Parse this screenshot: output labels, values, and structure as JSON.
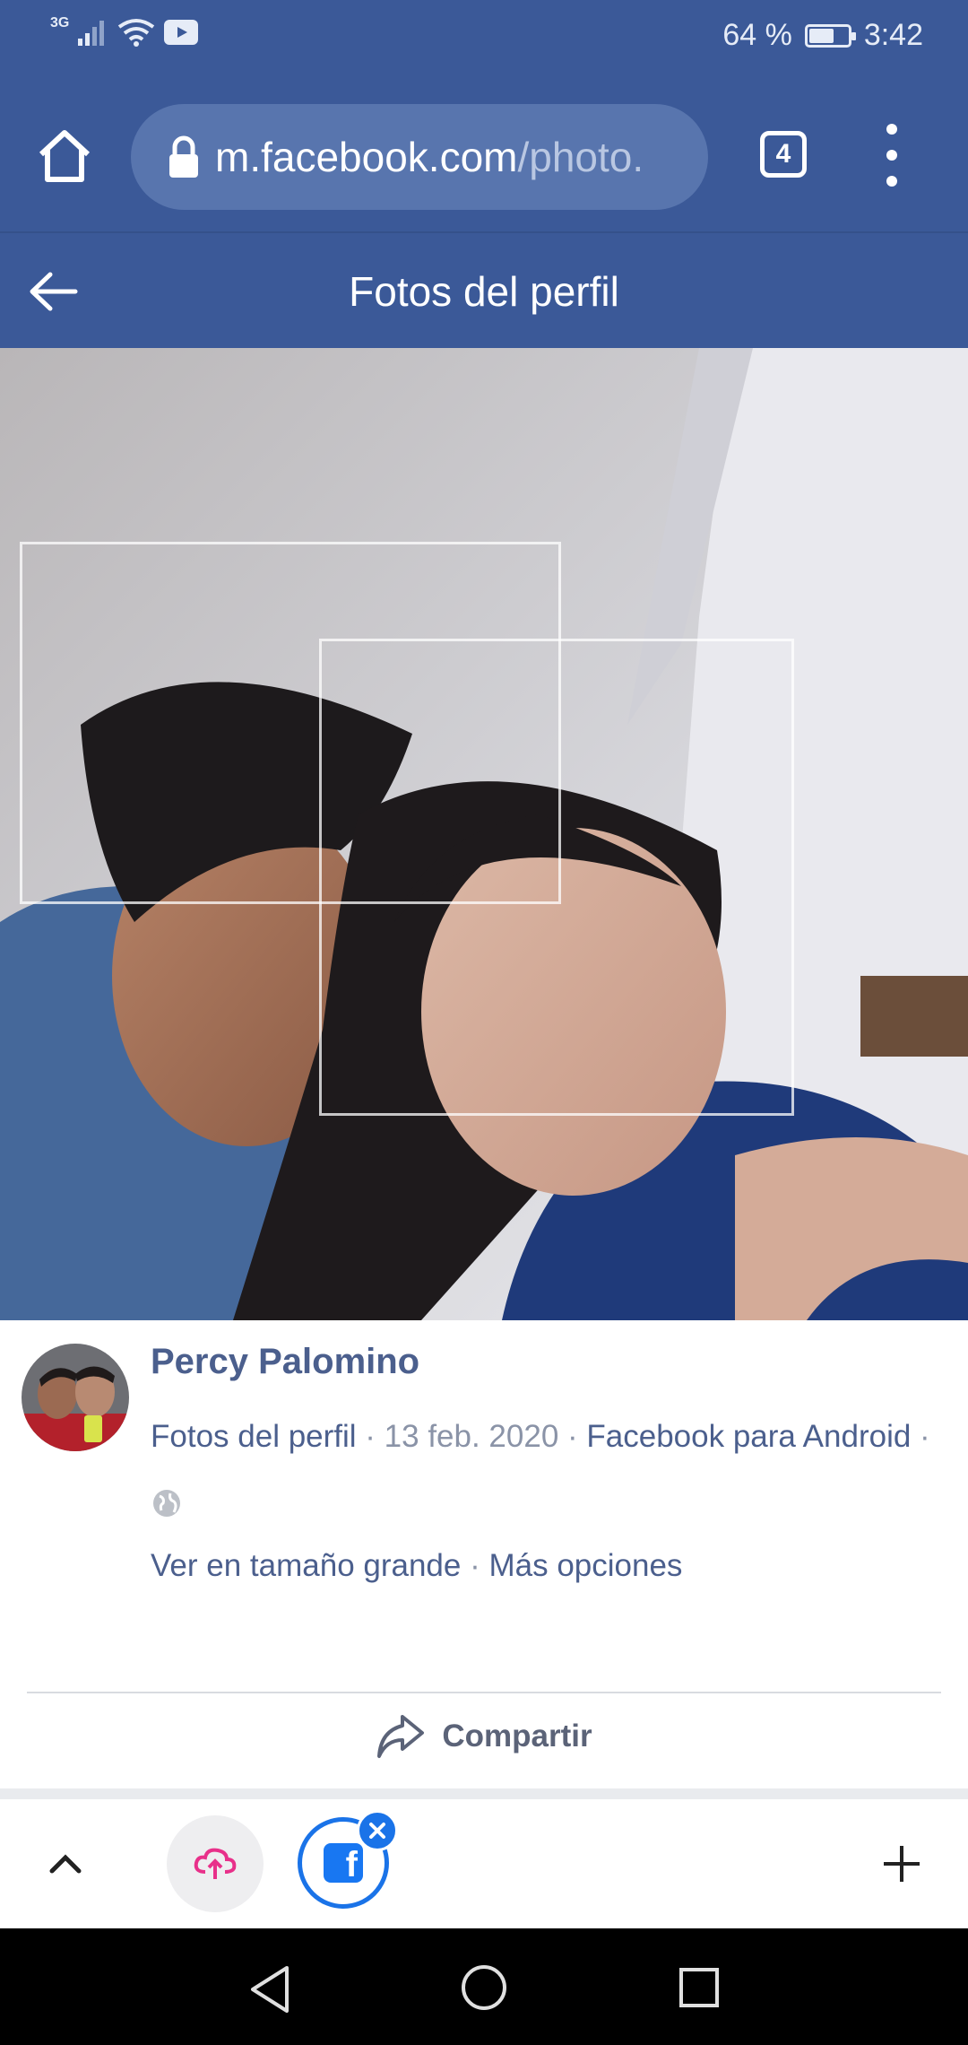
{
  "status_bar": {
    "network": "3G",
    "battery_text": "64 %",
    "battery_level": 0.64,
    "time": "3:42"
  },
  "browser": {
    "url_host": "m.facebook.com",
    "url_path": "/photo.",
    "tab_count": "4"
  },
  "page": {
    "title": "Fotos del perfil"
  },
  "post": {
    "author": "Percy Palomino",
    "album": "Fotos del perfil",
    "separator": " · ",
    "date": "13 feb. 2020",
    "source": "Facebook para Android",
    "trailing_separator": " ·",
    "view_large": "Ver en tamaño grande",
    "more_options": "Más opciones",
    "share_label": "Compartir"
  },
  "colors": {
    "facebook_blue": "#3b5998",
    "link_color": "#4b5f8d",
    "tab_accent": "#1a73e8"
  },
  "icons": [
    "home-icon",
    "lock-icon",
    "more-vert-icon",
    "back-arrow-icon",
    "globe-icon",
    "share-icon",
    "chevron-up-icon",
    "cloud-icon",
    "facebook-icon",
    "close-icon",
    "plus-icon",
    "nav-back-icon",
    "nav-home-icon",
    "nav-recent-icon"
  ]
}
